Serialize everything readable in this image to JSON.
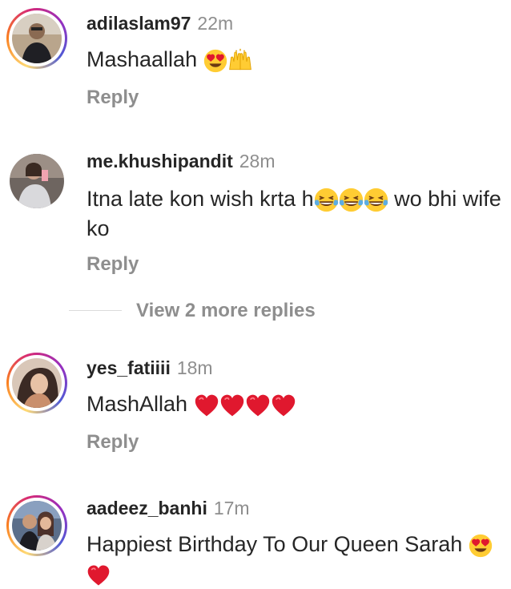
{
  "comments": [
    {
      "username": "adilaslam97",
      "time": "22m",
      "text": "Mashaallah",
      "emojis": [
        "heart-eyes",
        "raising-hands"
      ],
      "reply_label": "Reply"
    },
    {
      "username": "me.khushipandit",
      "time": "28m",
      "text_before": "Itna late kon wish krta h",
      "emojis": [
        "tears-of-joy",
        "tears-of-joy",
        "tears-of-joy"
      ],
      "text_after": " wo bhi wife ko",
      "reply_label": "Reply"
    },
    {
      "username": "yes_fatiiii",
      "time": "18m",
      "text": "MashAllah",
      "emojis": [
        "red-heart",
        "red-heart",
        "red-heart",
        "red-heart"
      ],
      "reply_label": "Reply"
    },
    {
      "username": "aadeez_banhi",
      "time": "17m",
      "text": "Happiest Birthday To Our Queen Sarah",
      "emojis": [
        "heart-eyes",
        "red-heart"
      ]
    }
  ],
  "view_more_replies": "View 2 more replies",
  "colors": {
    "text": "#262626",
    "secondary": "#8e8e8e",
    "divider": "#dbdbdb",
    "heart": "#e0182e"
  }
}
